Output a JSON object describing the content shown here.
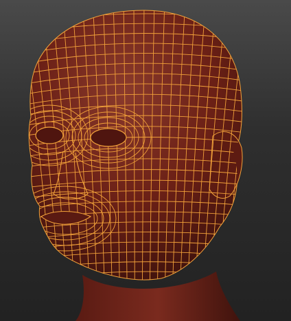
{
  "viewport": {
    "background_top": "#4a4a4a",
    "background_bottom": "#222222",
    "model": {
      "subject": "head",
      "display": "polygroup-wireframe-overlay",
      "surface_color": "#6b2016",
      "surface_highlight": "#8a3a2c",
      "wire_color": "#f2a23a"
    }
  }
}
